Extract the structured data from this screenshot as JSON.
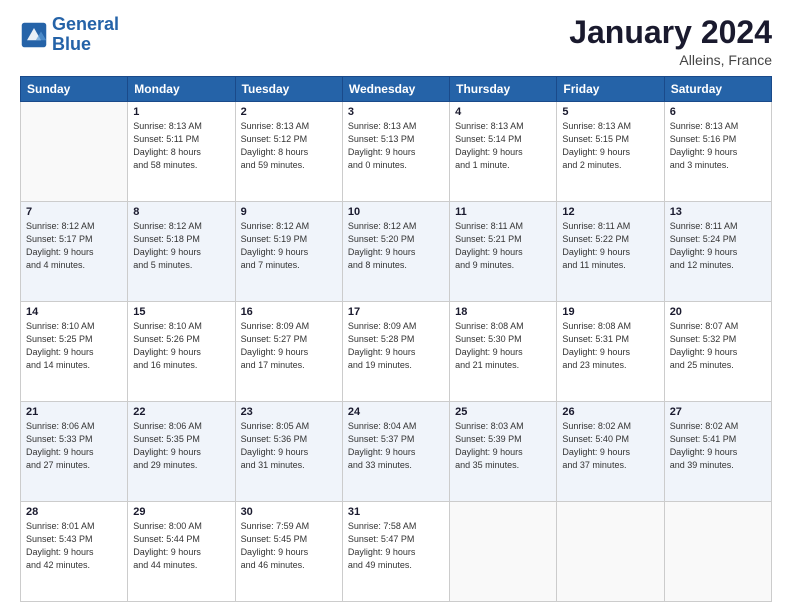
{
  "header": {
    "logo_line1": "General",
    "logo_line2": "Blue",
    "month_title": "January 2024",
    "location": "Alleins, France"
  },
  "days_of_week": [
    "Sunday",
    "Monday",
    "Tuesday",
    "Wednesday",
    "Thursday",
    "Friday",
    "Saturday"
  ],
  "weeks": [
    [
      {
        "day": "",
        "empty": true
      },
      {
        "day": "1",
        "sunrise": "Sunrise: 8:13 AM",
        "sunset": "Sunset: 5:11 PM",
        "daylight": "Daylight: 8 hours and 58 minutes."
      },
      {
        "day": "2",
        "sunrise": "Sunrise: 8:13 AM",
        "sunset": "Sunset: 5:12 PM",
        "daylight": "Daylight: 8 hours and 59 minutes."
      },
      {
        "day": "3",
        "sunrise": "Sunrise: 8:13 AM",
        "sunset": "Sunset: 5:13 PM",
        "daylight": "Daylight: 9 hours and 0 minutes."
      },
      {
        "day": "4",
        "sunrise": "Sunrise: 8:13 AM",
        "sunset": "Sunset: 5:14 PM",
        "daylight": "Daylight: 9 hours and 1 minute."
      },
      {
        "day": "5",
        "sunrise": "Sunrise: 8:13 AM",
        "sunset": "Sunset: 5:15 PM",
        "daylight": "Daylight: 9 hours and 2 minutes."
      },
      {
        "day": "6",
        "sunrise": "Sunrise: 8:13 AM",
        "sunset": "Sunset: 5:16 PM",
        "daylight": "Daylight: 9 hours and 3 minutes."
      }
    ],
    [
      {
        "day": "7",
        "sunrise": "Sunrise: 8:12 AM",
        "sunset": "Sunset: 5:17 PM",
        "daylight": "Daylight: 9 hours and 4 minutes."
      },
      {
        "day": "8",
        "sunrise": "Sunrise: 8:12 AM",
        "sunset": "Sunset: 5:18 PM",
        "daylight": "Daylight: 9 hours and 5 minutes."
      },
      {
        "day": "9",
        "sunrise": "Sunrise: 8:12 AM",
        "sunset": "Sunset: 5:19 PM",
        "daylight": "Daylight: 9 hours and 7 minutes."
      },
      {
        "day": "10",
        "sunrise": "Sunrise: 8:12 AM",
        "sunset": "Sunset: 5:20 PM",
        "daylight": "Daylight: 9 hours and 8 minutes."
      },
      {
        "day": "11",
        "sunrise": "Sunrise: 8:11 AM",
        "sunset": "Sunset: 5:21 PM",
        "daylight": "Daylight: 9 hours and 9 minutes."
      },
      {
        "day": "12",
        "sunrise": "Sunrise: 8:11 AM",
        "sunset": "Sunset: 5:22 PM",
        "daylight": "Daylight: 9 hours and 11 minutes."
      },
      {
        "day": "13",
        "sunrise": "Sunrise: 8:11 AM",
        "sunset": "Sunset: 5:24 PM",
        "daylight": "Daylight: 9 hours and 12 minutes."
      }
    ],
    [
      {
        "day": "14",
        "sunrise": "Sunrise: 8:10 AM",
        "sunset": "Sunset: 5:25 PM",
        "daylight": "Daylight: 9 hours and 14 minutes."
      },
      {
        "day": "15",
        "sunrise": "Sunrise: 8:10 AM",
        "sunset": "Sunset: 5:26 PM",
        "daylight": "Daylight: 9 hours and 16 minutes."
      },
      {
        "day": "16",
        "sunrise": "Sunrise: 8:09 AM",
        "sunset": "Sunset: 5:27 PM",
        "daylight": "Daylight: 9 hours and 17 minutes."
      },
      {
        "day": "17",
        "sunrise": "Sunrise: 8:09 AM",
        "sunset": "Sunset: 5:28 PM",
        "daylight": "Daylight: 9 hours and 19 minutes."
      },
      {
        "day": "18",
        "sunrise": "Sunrise: 8:08 AM",
        "sunset": "Sunset: 5:30 PM",
        "daylight": "Daylight: 9 hours and 21 minutes."
      },
      {
        "day": "19",
        "sunrise": "Sunrise: 8:08 AM",
        "sunset": "Sunset: 5:31 PM",
        "daylight": "Daylight: 9 hours and 23 minutes."
      },
      {
        "day": "20",
        "sunrise": "Sunrise: 8:07 AM",
        "sunset": "Sunset: 5:32 PM",
        "daylight": "Daylight: 9 hours and 25 minutes."
      }
    ],
    [
      {
        "day": "21",
        "sunrise": "Sunrise: 8:06 AM",
        "sunset": "Sunset: 5:33 PM",
        "daylight": "Daylight: 9 hours and 27 minutes."
      },
      {
        "day": "22",
        "sunrise": "Sunrise: 8:06 AM",
        "sunset": "Sunset: 5:35 PM",
        "daylight": "Daylight: 9 hours and 29 minutes."
      },
      {
        "day": "23",
        "sunrise": "Sunrise: 8:05 AM",
        "sunset": "Sunset: 5:36 PM",
        "daylight": "Daylight: 9 hours and 31 minutes."
      },
      {
        "day": "24",
        "sunrise": "Sunrise: 8:04 AM",
        "sunset": "Sunset: 5:37 PM",
        "daylight": "Daylight: 9 hours and 33 minutes."
      },
      {
        "day": "25",
        "sunrise": "Sunrise: 8:03 AM",
        "sunset": "Sunset: 5:39 PM",
        "daylight": "Daylight: 9 hours and 35 minutes."
      },
      {
        "day": "26",
        "sunrise": "Sunrise: 8:02 AM",
        "sunset": "Sunset: 5:40 PM",
        "daylight": "Daylight: 9 hours and 37 minutes."
      },
      {
        "day": "27",
        "sunrise": "Sunrise: 8:02 AM",
        "sunset": "Sunset: 5:41 PM",
        "daylight": "Daylight: 9 hours and 39 minutes."
      }
    ],
    [
      {
        "day": "28",
        "sunrise": "Sunrise: 8:01 AM",
        "sunset": "Sunset: 5:43 PM",
        "daylight": "Daylight: 9 hours and 42 minutes."
      },
      {
        "day": "29",
        "sunrise": "Sunrise: 8:00 AM",
        "sunset": "Sunset: 5:44 PM",
        "daylight": "Daylight: 9 hours and 44 minutes."
      },
      {
        "day": "30",
        "sunrise": "Sunrise: 7:59 AM",
        "sunset": "Sunset: 5:45 PM",
        "daylight": "Daylight: 9 hours and 46 minutes."
      },
      {
        "day": "31",
        "sunrise": "Sunrise: 7:58 AM",
        "sunset": "Sunset: 5:47 PM",
        "daylight": "Daylight: 9 hours and 49 minutes."
      },
      {
        "day": "",
        "empty": true
      },
      {
        "day": "",
        "empty": true
      },
      {
        "day": "",
        "empty": true
      }
    ]
  ]
}
